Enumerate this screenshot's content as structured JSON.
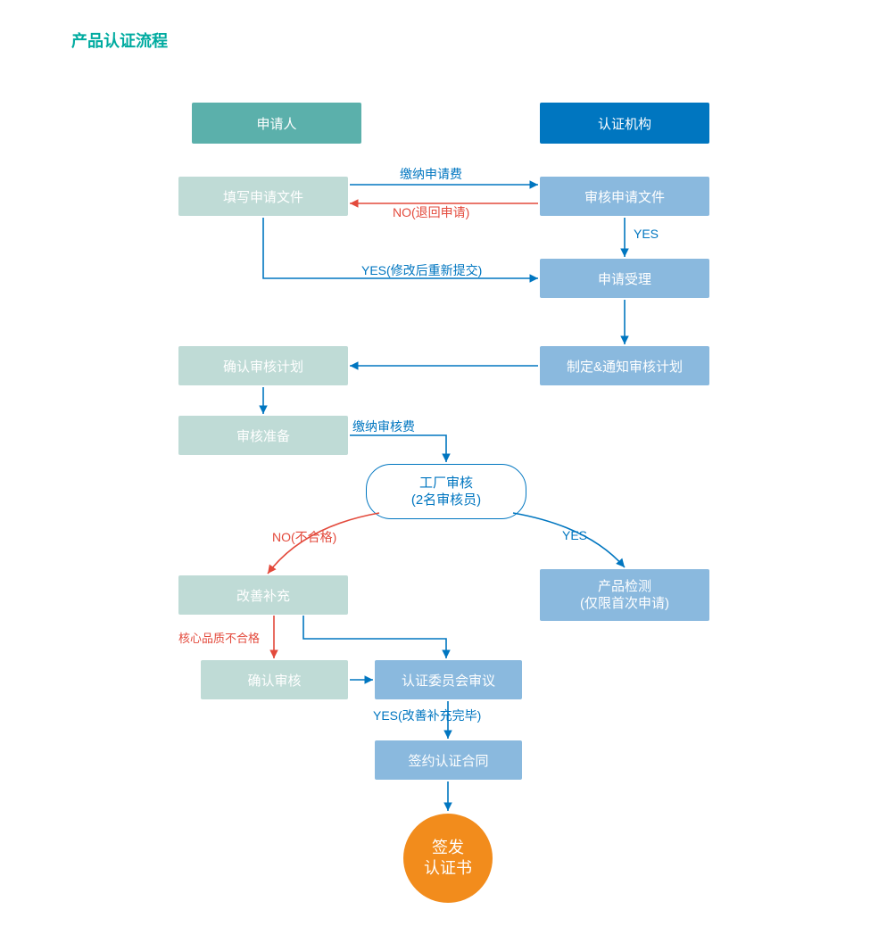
{
  "title": "产品认证流程",
  "headers": {
    "applicant": "申请人",
    "certBody": "认证机构"
  },
  "nodes": {
    "fillApplication": "填写申请文件",
    "reviewApplication": "审核申请文件",
    "applicationAccept": "申请受理",
    "makeAuditPlan": "制定&通知审核计划",
    "confirmAuditPlan": "确认审核计划",
    "auditPrep": "审核准备",
    "factoryAudit1": "工厂审核",
    "factoryAudit2": "(2名审核员)",
    "productTest1": "产品检测",
    "productTest2": "(仅限首次申请)",
    "improveSupp": "改善补充",
    "confirmAudit": "确认审核",
    "committeeReview": "认证委员会审议",
    "signContract": "签约认证合同",
    "issueCert1": "签发",
    "issueCert2": "认证书"
  },
  "labels": {
    "payAppFee": "缴纳申请费",
    "noReturn": "NO(退回申请)",
    "yes1": "YES",
    "yesResubmit": "YES(修改后重新提交)",
    "payAuditFee": "缴纳审核费",
    "noFail": "NO(不合格)",
    "yes2": "YES",
    "coreFail": "核心品质不合格",
    "yesImproved": "YES(改善补充完毕)"
  },
  "colors": {
    "title": "#00aba0",
    "headerApplicant": "#5bb0ab",
    "headerCert": "#0076c0",
    "applicantBox": "#bfdbd6",
    "certBox": "#8ab9de",
    "circle": "#f28c1c",
    "arrowBlue": "#0076c0",
    "arrowRed": "#e34a3c"
  }
}
